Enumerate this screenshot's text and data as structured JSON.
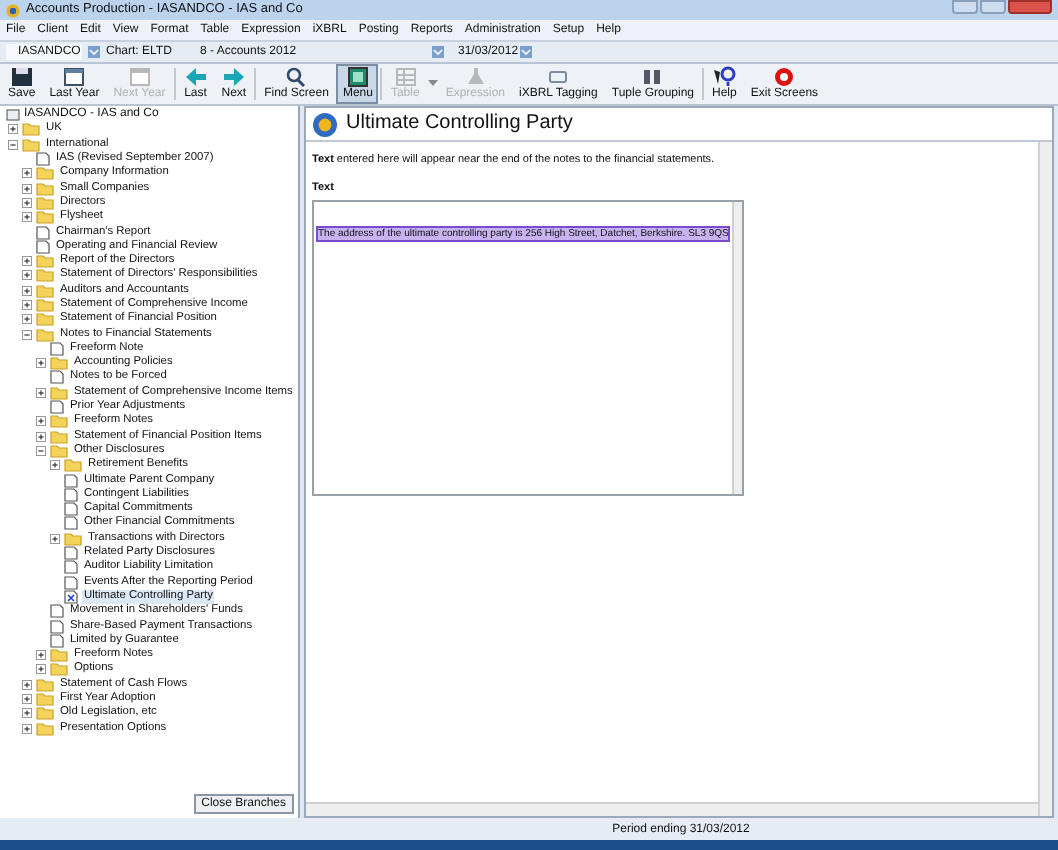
{
  "window": {
    "title": "Accounts Production - IASANDCO - IAS and Co"
  },
  "menu": [
    "File",
    "Client",
    "Edit",
    "View",
    "Format",
    "Table",
    "Expression",
    "iXBRL",
    "Posting",
    "Reports",
    "Administration",
    "Setup",
    "Help"
  ],
  "context": {
    "client": "IASANDCO",
    "chart": "Chart: ELTD",
    "accounts": "8 - Accounts 2012",
    "date": "31/03/2012"
  },
  "toolbar": [
    {
      "label": "Save",
      "kind": "save",
      "disabled": false,
      "pressed": false
    },
    {
      "label": "Last Year",
      "kind": "year",
      "disabled": false,
      "pressed": false
    },
    {
      "label": "Next Year",
      "kind": "year",
      "disabled": true,
      "pressed": false
    },
    {
      "label": "Last",
      "kind": "left",
      "disabled": false,
      "pressed": false
    },
    {
      "label": "Next",
      "kind": "right",
      "disabled": false,
      "pressed": false
    },
    {
      "label": "Find Screen",
      "kind": "find",
      "disabled": false,
      "pressed": false
    },
    {
      "label": "Menu",
      "kind": "menu",
      "disabled": false,
      "pressed": true
    },
    {
      "label": "Table",
      "kind": "table",
      "disabled": true,
      "pressed": false
    },
    {
      "label": "Expression",
      "kind": "expr",
      "disabled": true,
      "pressed": false
    },
    {
      "label": "iXBRL Tagging",
      "kind": "tag",
      "disabled": false,
      "pressed": false
    },
    {
      "label": "Tuple Grouping",
      "kind": "tuple",
      "disabled": false,
      "pressed": false
    },
    {
      "label": "Help",
      "kind": "help",
      "disabled": false,
      "pressed": false
    },
    {
      "label": "Exit Screens",
      "kind": "exit",
      "disabled": false,
      "pressed": false
    }
  ],
  "tree": {
    "root": "IASANDCO - IAS and Co",
    "items": [
      {
        "label": "UK",
        "kind": "folder",
        "expanded": false,
        "selected": false
      },
      {
        "label": "International",
        "kind": "folder",
        "expanded": true,
        "selected": false,
        "children": [
          {
            "label": "IAS (Revised September 2007)",
            "kind": "doc",
            "selected": false
          },
          {
            "label": "Company Information",
            "kind": "folder",
            "expanded": false,
            "selected": false
          },
          {
            "label": "Small Companies",
            "kind": "folder",
            "expanded": false,
            "selected": false
          },
          {
            "label": "Directors",
            "kind": "folder",
            "expanded": false,
            "selected": false
          },
          {
            "label": "Flysheet",
            "kind": "folder",
            "expanded": false,
            "selected": false
          },
          {
            "label": "Chairman's Report",
            "kind": "doc",
            "selected": false
          },
          {
            "label": "Operating and Financial Review",
            "kind": "doc",
            "selected": false
          },
          {
            "label": "Report of the Directors",
            "kind": "folder",
            "expanded": false,
            "selected": false
          },
          {
            "label": "Statement of Directors' Responsibilities",
            "kind": "folder",
            "expanded": false,
            "selected": false
          },
          {
            "label": "Auditors and Accountants",
            "kind": "folder",
            "expanded": false,
            "selected": false
          },
          {
            "label": "Statement of Comprehensive Income",
            "kind": "folder",
            "expanded": false,
            "selected": false
          },
          {
            "label": "Statement of Financial Position",
            "kind": "folder",
            "expanded": false,
            "selected": false
          },
          {
            "label": "Notes to Financial Statements",
            "kind": "folder",
            "expanded": true,
            "selected": false,
            "children": [
              {
                "label": "Freeform Note",
                "kind": "doc",
                "selected": false
              },
              {
                "label": "Accounting Policies",
                "kind": "folder",
                "expanded": false,
                "selected": false
              },
              {
                "label": "Notes to be Forced",
                "kind": "doc",
                "selected": false
              },
              {
                "label": "Statement of Comprehensive Income Items",
                "kind": "folder",
                "expanded": false,
                "selected": false
              },
              {
                "label": "Prior Year Adjustments",
                "kind": "doc",
                "selected": false
              },
              {
                "label": "Freeform Notes",
                "kind": "folder",
                "expanded": false,
                "selected": false
              },
              {
                "label": "Statement of Financial Position Items",
                "kind": "folder",
                "expanded": false,
                "selected": false
              },
              {
                "label": "Other Disclosures",
                "kind": "folder",
                "expanded": true,
                "selected": false,
                "children": [
                  {
                    "label": "Retirement Benefits",
                    "kind": "folder",
                    "expanded": false,
                    "selected": false
                  },
                  {
                    "label": "Ultimate Parent Company",
                    "kind": "doc",
                    "selected": false
                  },
                  {
                    "label": "Contingent Liabilities",
                    "kind": "doc",
                    "selected": false
                  },
                  {
                    "label": "Capital Commitments",
                    "kind": "doc",
                    "selected": false
                  },
                  {
                    "label": "Other Financial Commitments",
                    "kind": "doc",
                    "selected": false
                  },
                  {
                    "label": "Transactions with Directors",
                    "kind": "folder",
                    "expanded": false,
                    "selected": false
                  },
                  {
                    "label": "Related Party Disclosures",
                    "kind": "doc",
                    "selected": false
                  },
                  {
                    "label": "Auditor Liability Limitation",
                    "kind": "doc",
                    "selected": false
                  },
                  {
                    "label": "Events After the Reporting Period",
                    "kind": "doc",
                    "selected": false
                  },
                  {
                    "label": "Ultimate Controlling Party",
                    "kind": "doc",
                    "selected": true
                  }
                ]
              },
              {
                "label": "Movement in Shareholders' Funds",
                "kind": "doc",
                "selected": false
              },
              {
                "label": "Share-Based Payment Transactions",
                "kind": "doc",
                "selected": false
              },
              {
                "label": "Limited by Guarantee",
                "kind": "doc",
                "selected": false
              },
              {
                "label": "Freeform Notes",
                "kind": "folder",
                "expanded": false,
                "selected": false
              },
              {
                "label": "Options",
                "kind": "folder",
                "expanded": false,
                "selected": false
              }
            ]
          },
          {
            "label": "Statement of Cash Flows",
            "kind": "folder",
            "expanded": false,
            "selected": false
          },
          {
            "label": "First Year Adoption",
            "kind": "folder",
            "expanded": false,
            "selected": false
          },
          {
            "label": "Old Legislation, etc",
            "kind": "folder",
            "expanded": false,
            "selected": false
          },
          {
            "label": "Presentation Options",
            "kind": "folder",
            "expanded": false,
            "selected": false
          }
        ]
      }
    ]
  },
  "close_branches": "Close Branches",
  "screen": {
    "title": "Ultimate Controlling Party",
    "intro": "**Text** entered here will appear near the end of the notes to the financial statements.",
    "field_label": "Text",
    "value": "The address of the ultimate controlling party is 256 High Street, Datchet, Berkshire. SL3 9QS"
  },
  "status_bar": "Period ending 31/03/2012"
}
